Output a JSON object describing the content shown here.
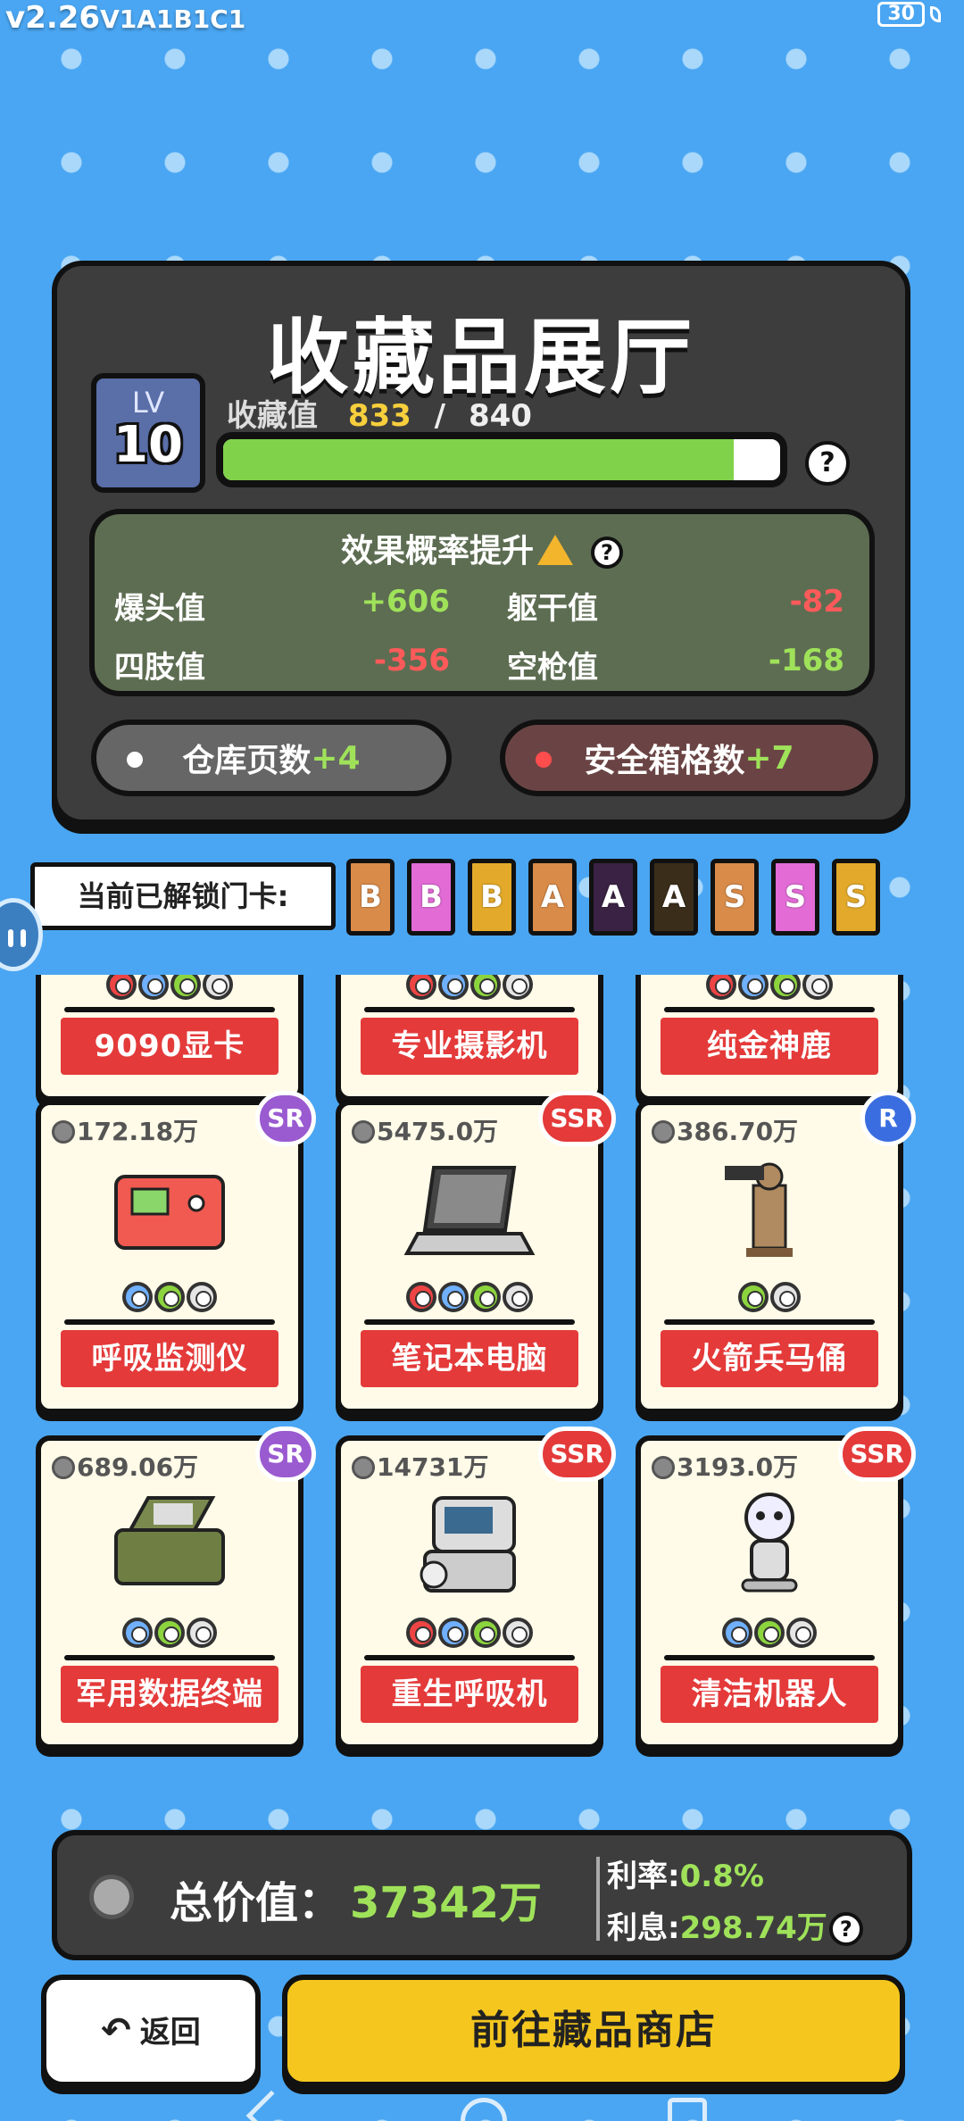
{
  "status": {
    "version": "v2.26",
    "build": "V1A1B1C1",
    "battery": "30"
  },
  "hall": {
    "title": "收藏品展厅",
    "level_label": "LV",
    "level": "10",
    "collection_label": "收藏值",
    "collection_current": "833",
    "collection_sep": "/",
    "collection_max": "840",
    "progress_fraction": 0.917,
    "help_symbol": "?"
  },
  "effect": {
    "title": "效果概率提升",
    "stats": [
      {
        "label": "爆头值",
        "value": "+606",
        "sign": "pos"
      },
      {
        "label": "躯干值",
        "value": "-82",
        "sign": "neg"
      },
      {
        "label": "四肢值",
        "value": "-356",
        "sign": "neg"
      },
      {
        "label": "空枪值",
        "value": "-168",
        "sign": "pos"
      }
    ]
  },
  "bonuses": {
    "warehouse_label": "仓库页数",
    "warehouse_value": "+4",
    "safe_label": "安全箱格数",
    "safe_value": "+7"
  },
  "unlock": {
    "label": "当前已解锁门卡:",
    "cards": [
      {
        "grade": "B",
        "color": "#d98b4a"
      },
      {
        "grade": "B",
        "color": "#e26bd6"
      },
      {
        "grade": "B",
        "color": "#e2a92a"
      },
      {
        "grade": "A",
        "color": "#d98b4a"
      },
      {
        "grade": "A",
        "color": "#3a2244"
      },
      {
        "grade": "A",
        "color": "#3a2e1a"
      },
      {
        "grade": "S",
        "color": "#d98b4a"
      },
      {
        "grade": "S",
        "color": "#e26bd6"
      },
      {
        "grade": "S",
        "color": "#e2a92a"
      }
    ]
  },
  "items": [
    {
      "name": "9090显卡",
      "price": "",
      "rarity": "",
      "slots": [
        "red",
        "blue",
        "green",
        "grey"
      ],
      "icon": "graphics-card-icon"
    },
    {
      "name": "专业摄影机",
      "price": "",
      "rarity": "",
      "slots": [
        "red",
        "blue",
        "green",
        "grey"
      ],
      "icon": "camera-icon"
    },
    {
      "name": "纯金神鹿",
      "price": "",
      "rarity": "",
      "slots": [
        "red",
        "blue",
        "green",
        "grey"
      ],
      "icon": "golden-deer-icon"
    },
    {
      "name": "呼吸监测仪",
      "price": "172.18万",
      "rarity": "SR",
      "slots": [
        "blue",
        "green",
        "grey"
      ],
      "icon": "breath-monitor-icon"
    },
    {
      "name": "笔记本电脑",
      "price": "5475.0万",
      "rarity": "SSR",
      "slots": [
        "red",
        "blue",
        "green",
        "grey"
      ],
      "icon": "laptop-icon"
    },
    {
      "name": "火箭兵马俑",
      "price": "386.70万",
      "rarity": "R",
      "slots": [
        "green",
        "grey"
      ],
      "icon": "terracotta-warrior-icon"
    },
    {
      "name": "军用数据终端",
      "price": "689.06万",
      "rarity": "SR",
      "slots": [
        "blue",
        "green",
        "grey"
      ],
      "icon": "data-terminal-icon"
    },
    {
      "name": "重生呼吸机",
      "price": "14731万",
      "rarity": "SSR",
      "slots": [
        "red",
        "blue",
        "green",
        "grey"
      ],
      "icon": "ventilator-icon"
    },
    {
      "name": "清洁机器人",
      "price": "3193.0万",
      "rarity": "SSR",
      "slots": [
        "blue",
        "green",
        "grey"
      ],
      "icon": "cleaning-robot-icon"
    }
  ],
  "total": {
    "label": "总价值：",
    "value": "37342万",
    "rate_label": "利率:",
    "rate_value": "0.8%",
    "interest_label": "利息:",
    "interest_value": "298.74万"
  },
  "buttons": {
    "back_label": "返回",
    "shop_label": "前往藏品商店"
  }
}
